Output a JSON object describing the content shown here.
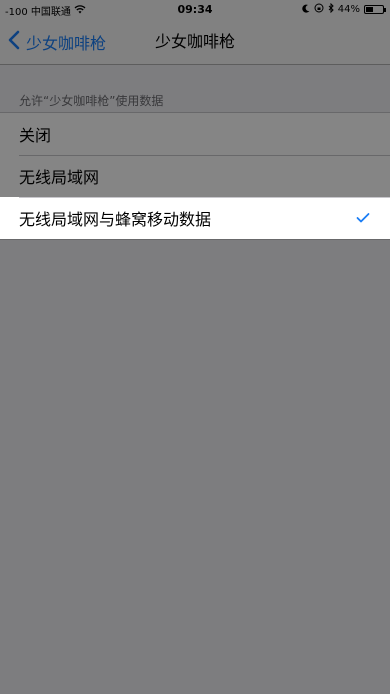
{
  "status_bar": {
    "carrier": "-100 中国联通",
    "time": "09:34",
    "battery": "44%"
  },
  "nav": {
    "back_label": "少女咖啡枪",
    "title": "少女咖啡枪"
  },
  "section": {
    "header": "允许“少女咖啡枪”使用数据"
  },
  "options": [
    {
      "label": "关闭",
      "selected": false
    },
    {
      "label": "无线局域网",
      "selected": false
    },
    {
      "label": "无线局域网与蜂窝移动数据",
      "selected": true
    }
  ],
  "colors": {
    "accent": "#1a7df5",
    "background": "#efeff4",
    "overlay": "rgba(0,0,0,0.48)"
  },
  "icons": {
    "back": "chevron-left-icon",
    "check": "checkmark-icon",
    "wifi": "wifi-icon",
    "moon": "moon-icon",
    "lock": "rotation-lock-icon",
    "bluetooth": "bluetooth-icon",
    "battery": "battery-icon"
  }
}
